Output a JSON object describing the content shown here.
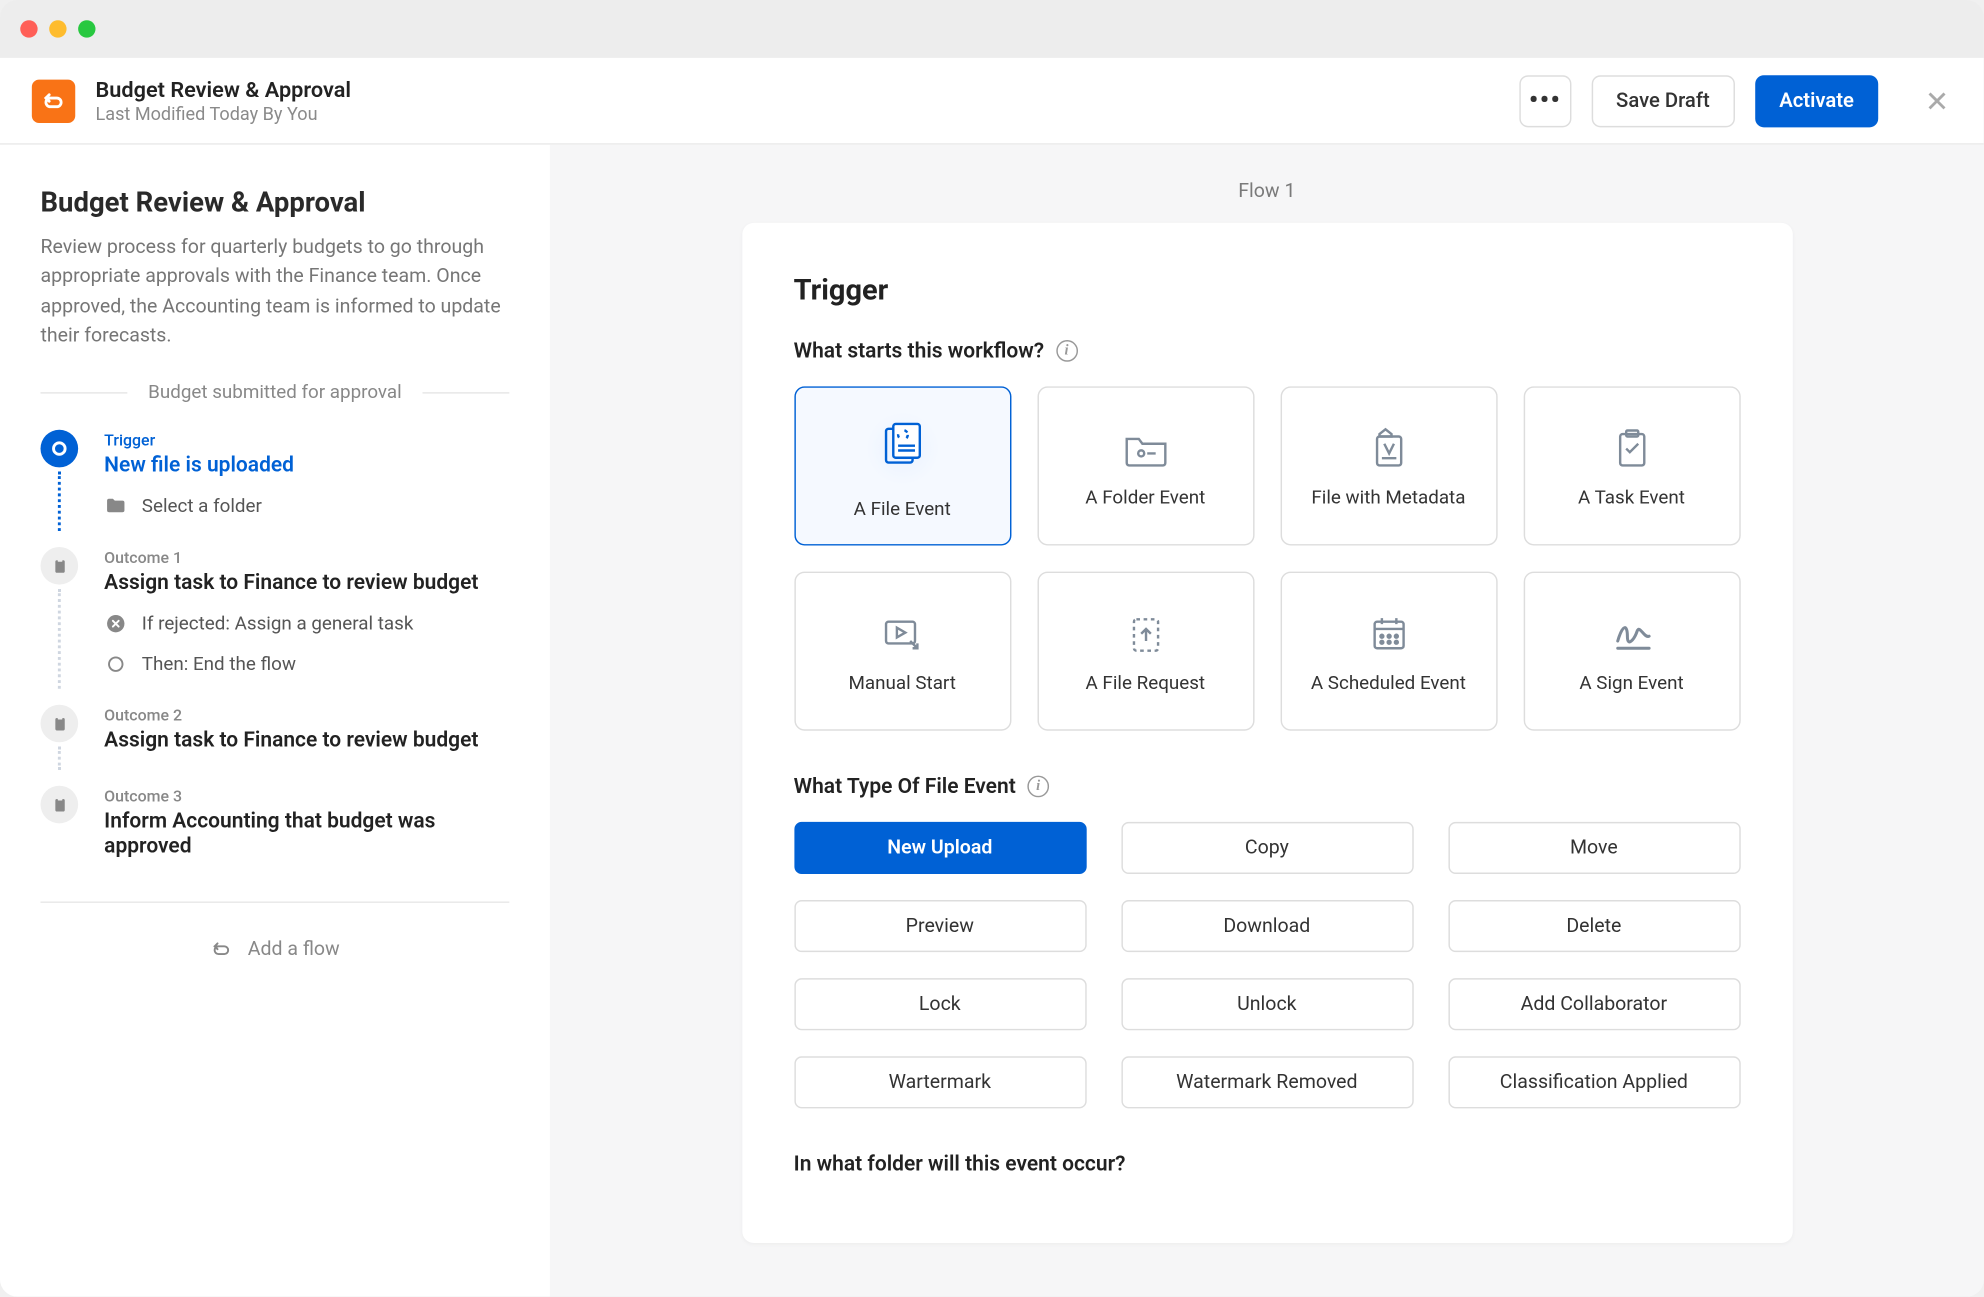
{
  "header": {
    "title": "Budget Review & Approval",
    "subtitle": "Last Modified Today By You",
    "more_label": "•••",
    "save_label": "Save Draft",
    "activate_label": "Activate"
  },
  "side": {
    "title": "Budget Review & Approval",
    "desc": "Review process for quarterly budgets to go through appropriate approvals with the Finance team. Once approved, the Accounting team is informed to update their forecasts.",
    "div_label": "Budget submitted for approval",
    "trigger_label": "Trigger",
    "trigger_title": "New file is uploaded",
    "trigger_sub": "Select a folder",
    "o1_label": "Outcome 1",
    "o1_title": "Assign task to Finance to review budget",
    "o1_s1": "If rejected: Assign a general task",
    "o1_s2": "Then: End the flow",
    "o2_label": "Outcome 2",
    "o2_title": "Assign task to Finance to review budget",
    "o3_label": "Outcome 3",
    "o3_title": "Inform Accounting that budget was approved",
    "add_flow": "Add a flow"
  },
  "main": {
    "flow_label": "Flow 1",
    "trigger_heading": "Trigger",
    "q1": "What starts this workflow?",
    "triggers": {
      "t0": "A File Event",
      "t1": "A Folder Event",
      "t2": "File with Metadata",
      "t3": "A Task Event",
      "t4": "Manual Start",
      "t5": "A File Request",
      "t6": "A Scheduled Event",
      "t7": "A Sign Event"
    },
    "q2": "What Type Of File Event",
    "events": {
      "e0": "New Upload",
      "e1": "Copy",
      "e2": "Move",
      "e3": "Preview",
      "e4": "Download",
      "e5": "Delete",
      "e6": "Lock",
      "e7": "Unlock",
      "e8": "Add Collaborator",
      "e9": "Wartermark",
      "e10": "Watermark Removed",
      "e11": "Classification Applied"
    },
    "q3": "In what folder will this event occur?"
  }
}
